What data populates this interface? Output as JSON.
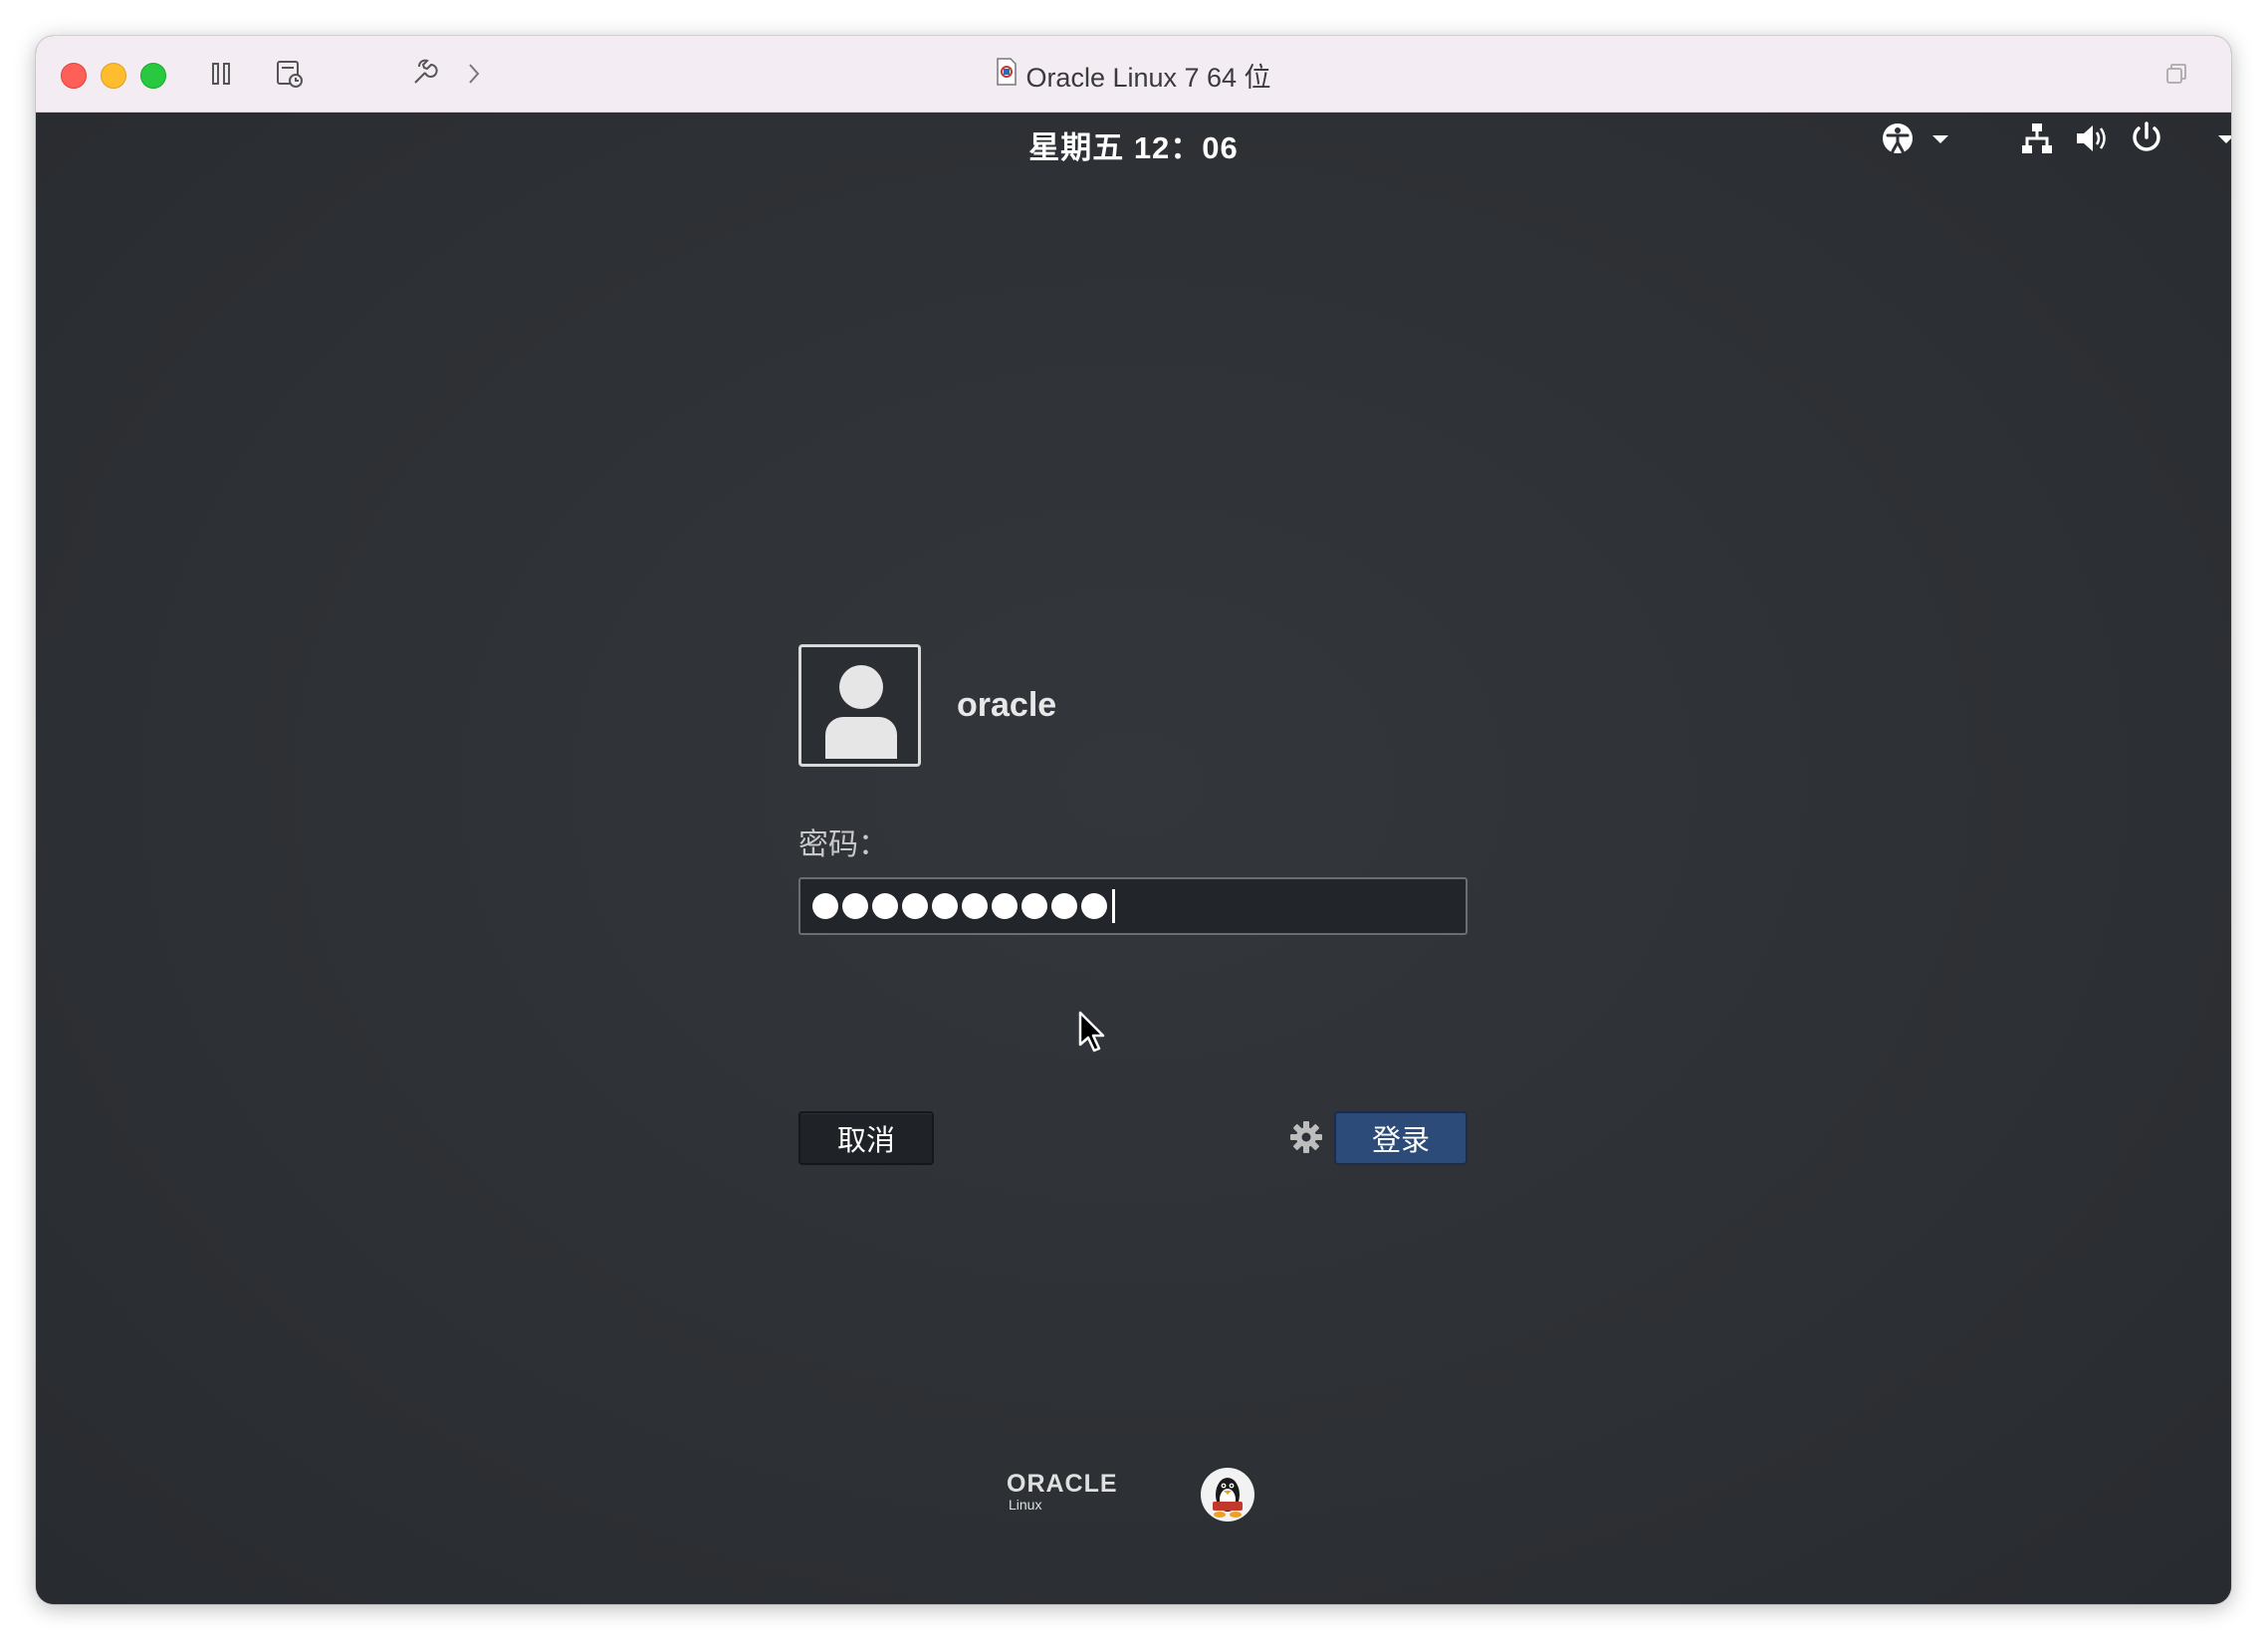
{
  "window": {
    "title": "Oracle Linux 7 64 位"
  },
  "topbar": {
    "clock": "星期五 12：06"
  },
  "login": {
    "username": "oracle",
    "password_label": "密码：",
    "password_masked_count": 10,
    "cancel_label": "取消",
    "login_label": "登录"
  },
  "branding": {
    "oracle_word": "ORACLE",
    "oracle_sub": "Linux"
  },
  "colors": {
    "background": "#2d3034",
    "login_button": "#2c4b78",
    "titlebar": "#f3ecf2"
  }
}
